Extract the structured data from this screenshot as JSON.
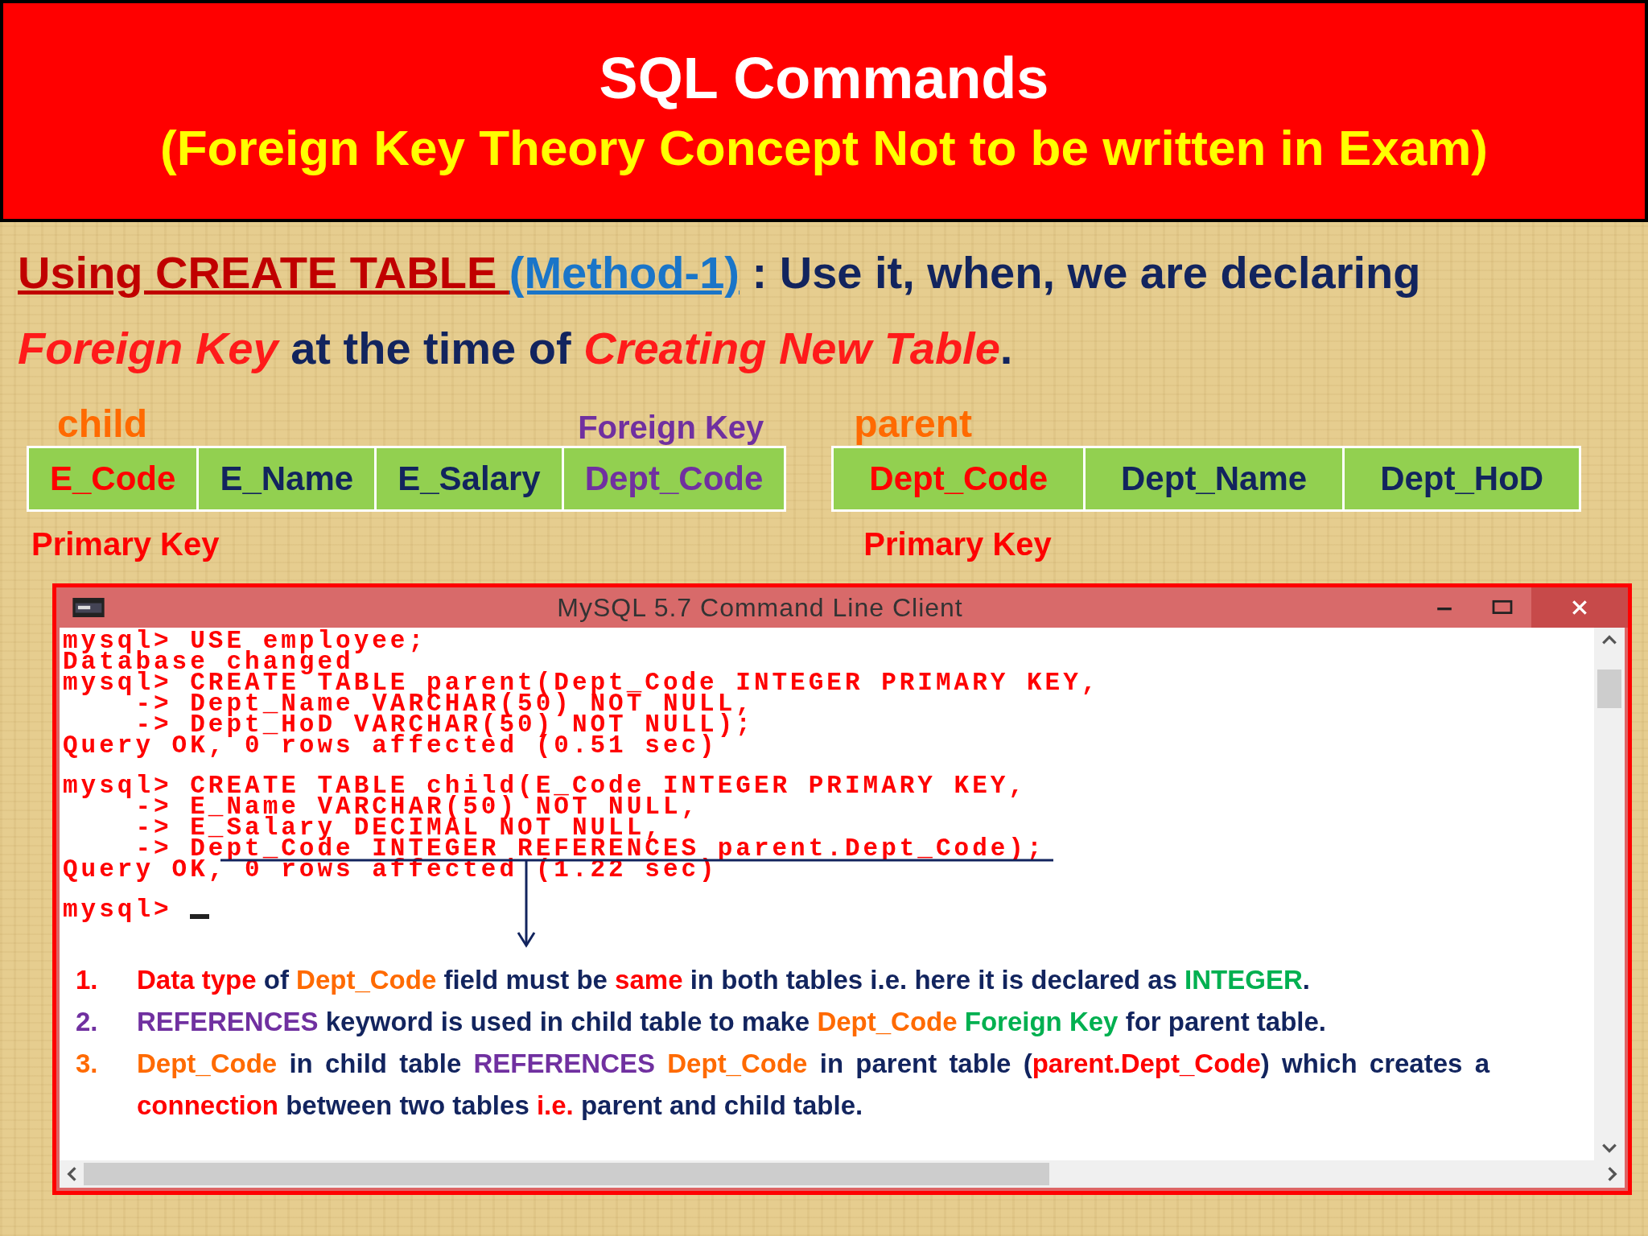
{
  "header": {
    "title": "SQL Commands",
    "subtitle": "(Foreign Key Theory Concept Not to be written in Exam)"
  },
  "intro": [
    [
      {
        "kind": "heading",
        "text": "Using CREATE TABLE "
      },
      {
        "kind": "link",
        "text": "(Method-1)"
      },
      {
        "kind": "text",
        "text": " : Use it, when, we are declaring"
      }
    ],
    [
      {
        "kind": "emphasis",
        "text": "Foreign Key"
      },
      {
        "kind": "text",
        "text": " at the time of "
      },
      {
        "kind": "emphasis",
        "text": "Creating New Table"
      },
      {
        "kind": "text",
        "text": "."
      }
    ]
  ],
  "tables": [
    {
      "label": "child",
      "key_label": "Foreign Key",
      "primary_label": "Primary Key",
      "columns": [
        {
          "name": "E_Code",
          "kind": "primary"
        },
        {
          "name": "E_Name",
          "kind": "attribute"
        },
        {
          "name": "E_Salary",
          "kind": "attribute"
        },
        {
          "name": "Dept_Code",
          "kind": "foreign"
        }
      ]
    },
    {
      "label": "parent",
      "primary_label": "Primary Key",
      "columns": [
        {
          "name": "Dept_Code",
          "kind": "primary"
        },
        {
          "name": "Dept_Name",
          "kind": "attribute"
        },
        {
          "name": "Dept_HoD",
          "kind": "attribute"
        }
      ]
    }
  ],
  "window": {
    "title": "MySQL 5.7 Command Line Client",
    "console_blocks": [
      [
        "mysql> USE employee;",
        "Database changed",
        "mysql> CREATE TABLE parent(Dept_Code INTEGER PRIMARY KEY,",
        "    -> Dept_Name VARCHAR(50) NOT NULL,",
        "    -> Dept_HoD VARCHAR(50) NOT NULL);",
        "Query OK, 0 rows affected (0.51 sec)"
      ],
      [
        "mysql> CREATE TABLE child(E_Code INTEGER PRIMARY KEY,",
        "    -> E_Name VARCHAR(50) NOT NULL,",
        "    -> E_Salary DECIMAL NOT NULL,",
        "    -> Dept_Code INTEGER REFERENCES parent.Dept_Code);",
        "Query OK, 0 rows affected (1.22 sec)"
      ],
      [
        "mysql>"
      ]
    ],
    "notes": [
      {
        "number": "1.",
        "kind": "alert",
        "segments": [
          {
            "text": "Data type",
            "kind": "alert"
          },
          {
            "text": " of ",
            "kind": "plain"
          },
          {
            "text": "Dept_Code",
            "kind": "field"
          },
          {
            "text": "  field must be ",
            "kind": "plain"
          },
          {
            "text": "same",
            "kind": "alert"
          },
          {
            "text": " in both tables i.e. here it is declared as ",
            "kind": "plain"
          },
          {
            "text": "INTEGER",
            "kind": "accent"
          },
          {
            "text": ".",
            "kind": "plain"
          }
        ]
      },
      {
        "number": "2.",
        "kind": "keyword",
        "segments": [
          {
            "text": "REFERENCES",
            "kind": "keyword"
          },
          {
            "text": " keyword is used in child table to make ",
            "kind": "plain"
          },
          {
            "text": "Dept_Code",
            "kind": "field"
          },
          {
            "text": " Foreign Key",
            "kind": "accent"
          },
          {
            "text": " for parent table.",
            "kind": "plain"
          }
        ]
      },
      {
        "number": "3.",
        "kind": "field",
        "segments": [
          {
            "text": "Dept_Code",
            "kind": "field"
          },
          {
            "text": " in child table ",
            "kind": "plain"
          },
          {
            "text": "REFERENCES",
            "kind": "keyword"
          },
          {
            "text": " Dept_Code",
            "kind": "field"
          },
          {
            "text": " in parent table (",
            "kind": "plain"
          },
          {
            "text": "parent.Dept_Code",
            "kind": "alert"
          },
          {
            "text": ") which creates a ",
            "kind": "plain"
          },
          {
            "text": "connection",
            "kind": "alert"
          },
          {
            "text": " between two tables ",
            "kind": "plain"
          },
          {
            "text": "i.e.",
            "kind": "alert"
          },
          {
            "text": " parent and child table.",
            "kind": "plain"
          }
        ]
      }
    ]
  }
}
